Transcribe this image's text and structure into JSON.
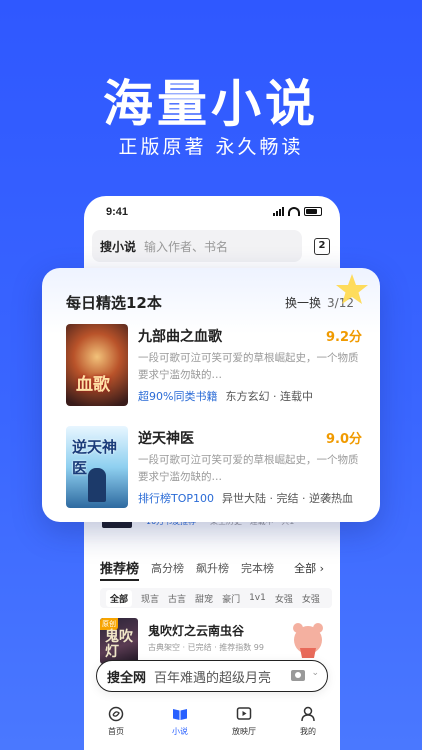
{
  "hero": {
    "title": "海量小说",
    "subtitle": "正版原著 永久畅读"
  },
  "status_bar": {
    "time": "9:41"
  },
  "search": {
    "label": "搜小说",
    "placeholder": "输入作者、书名",
    "badge": "2"
  },
  "daily_card": {
    "title": "每日精选12本",
    "refresh_label": "换一换",
    "page": "3/12",
    "books": [
      {
        "cover_text": "血歌",
        "title": "九部曲之血歌",
        "score": "9.2分",
        "description": "一段可歌可泣可笑可爱的草根崛起史，一个物质要求宁滥勿缺的…",
        "highlight": "超90%同类书籍",
        "meta": "东方玄幻 · 连载中"
      },
      {
        "cover_text": "逆天神医",
        "title": "逆天神医",
        "score": "9.0分",
        "description": "一段可歌可泣可笑可爱的草根崛起史，一个物质要求宁滥勿缺的…",
        "highlight": "排行榜TOP100",
        "meta": "异世大陆 · 完结 · 逆袭热血"
      }
    ]
  },
  "peek_row": {
    "text1": "10万书友推荐",
    "text2": "架空历史 · 连载中 · 共1"
  },
  "ranking": {
    "tabs": [
      "推荐榜",
      "高分榜",
      "飙升榜",
      "完本榜"
    ],
    "all_label": "全部 ›",
    "chips": [
      "全部",
      "现言",
      "古言",
      "甜宠",
      "豪门",
      "1v1",
      "女强",
      "女强"
    ],
    "item": {
      "cover_tag": "原创",
      "cover_text": "鬼吹灯",
      "title": "鬼吹灯之云南虫谷",
      "meta": "古典架空 · 已完结 · 推荐指数 99"
    }
  },
  "bottom_search": {
    "label": "搜全网",
    "query": "百年难遇的超级月亮"
  },
  "tabbar": {
    "items": [
      {
        "label": "首页",
        "icon": "home-icon"
      },
      {
        "label": "小说",
        "icon": "book-icon"
      },
      {
        "label": "放映厅",
        "icon": "video-icon"
      },
      {
        "label": "我的",
        "icon": "profile-icon"
      }
    ]
  },
  "colors": {
    "background": "#3460ff",
    "accent": "#2860ff",
    "score": "#f09a00",
    "link": "#2a6bd6"
  }
}
